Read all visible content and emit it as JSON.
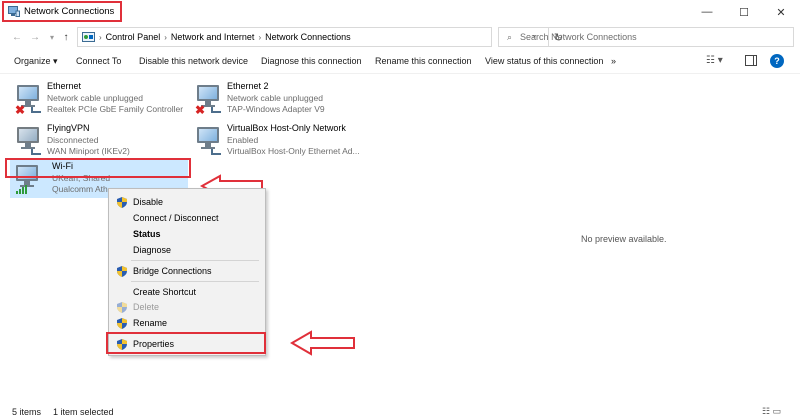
{
  "window": {
    "title": "Network Connections",
    "title_icon": "network-connections-icon",
    "minimize_icon": "minimize-icon",
    "maximize_icon": "maximize-icon",
    "close_icon": "close-icon"
  },
  "addressbar": {
    "breadcrumbs": [
      "Control Panel",
      "Network and Internet",
      "Network Connections"
    ],
    "search_placeholder": "Search Network Connections"
  },
  "commandbar": {
    "organize": "Organize ▾",
    "connect_to": "Connect To",
    "disable": "Disable this network device",
    "diagnose": "Diagnose this connection",
    "rename": "Rename this connection",
    "view_status": "View status of this connection",
    "more": "»"
  },
  "items": [
    {
      "name": "Ethernet",
      "status": "Network cable unplugged",
      "device": "Realtek PCIe GbE Family Controller",
      "icon": "ethernet-icon",
      "error": true
    },
    {
      "name": "Ethernet 2",
      "status": "Network cable unplugged",
      "device": "TAP-Windows Adapter V9",
      "icon": "ethernet-icon",
      "error": true
    },
    {
      "name": "FlyingVPN",
      "status": "Disconnected",
      "device": "WAN Miniport (IKEv2)",
      "icon": "vpn-icon",
      "error": false
    },
    {
      "name": "VirtualBox Host-Only Network",
      "status": "Enabled",
      "device": "VirtualBox Host-Only Ethernet Ad...",
      "icon": "ethernet-icon",
      "error": false
    },
    {
      "name": "Wi-Fi",
      "status": "UKean, Shared",
      "device": "Qualcomm Ath",
      "icon": "wifi-icon",
      "error": false
    }
  ],
  "context_menu": {
    "items": [
      {
        "label": "Disable",
        "shield": true,
        "bold": false,
        "disabled": false
      },
      {
        "label": "Connect / Disconnect",
        "shield": false,
        "bold": false,
        "disabled": false
      },
      {
        "label": "Status",
        "shield": false,
        "bold": true,
        "disabled": false
      },
      {
        "label": "Diagnose",
        "shield": false,
        "bold": false,
        "disabled": false
      },
      {
        "label": "Bridge Connections",
        "shield": true,
        "bold": false,
        "disabled": false
      },
      {
        "label": "Create Shortcut",
        "shield": false,
        "bold": false,
        "disabled": false
      },
      {
        "label": "Delete",
        "shield": true,
        "bold": false,
        "disabled": true
      },
      {
        "label": "Rename",
        "shield": true,
        "bold": false,
        "disabled": false
      },
      {
        "label": "Properties",
        "shield": true,
        "bold": false,
        "disabled": false
      }
    ]
  },
  "preview": {
    "text": "No preview available."
  },
  "statusbar": {
    "count": "5 items",
    "selected": "1 item selected"
  },
  "colors": {
    "accent": "#0067c0",
    "highlight": "#e0303a",
    "selection": "#cce8ff"
  }
}
